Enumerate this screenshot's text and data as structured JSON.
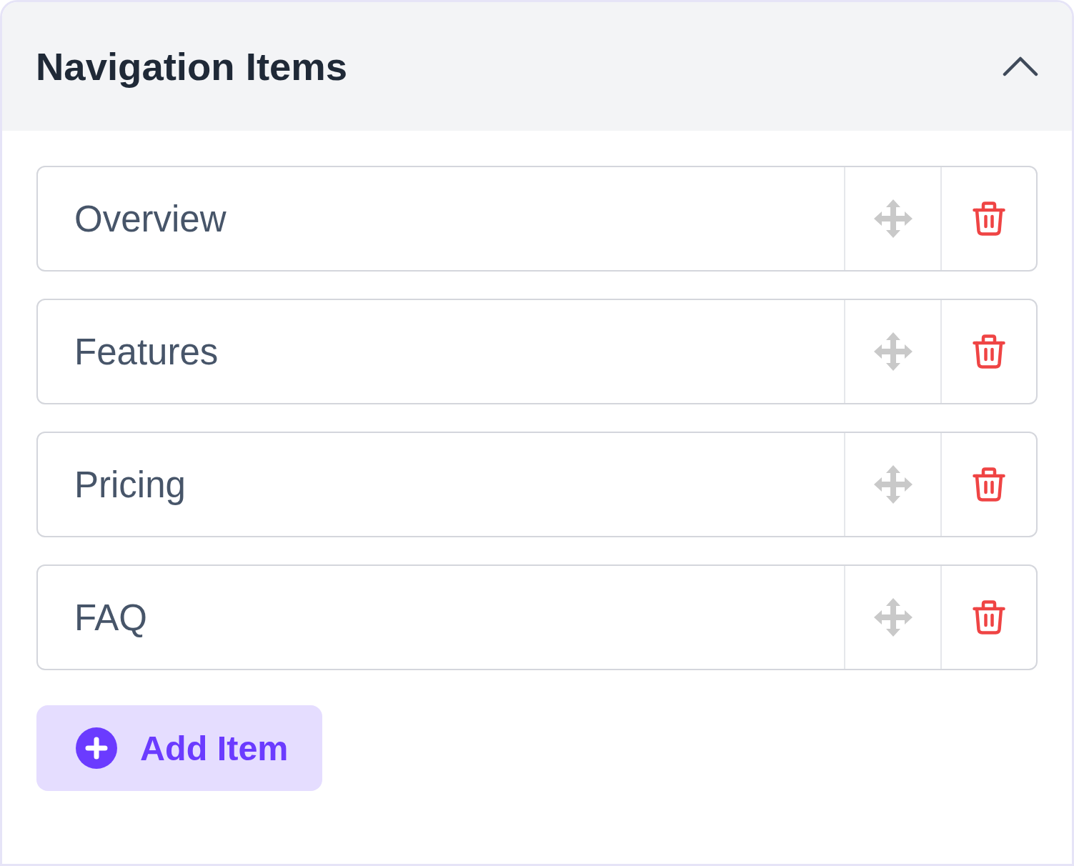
{
  "panel": {
    "title": "Navigation Items",
    "expanded": true
  },
  "items": [
    {
      "label": "Overview"
    },
    {
      "label": "Features"
    },
    {
      "label": "Pricing"
    },
    {
      "label": "FAQ"
    }
  ],
  "add_button": {
    "label": "Add Item"
  }
}
